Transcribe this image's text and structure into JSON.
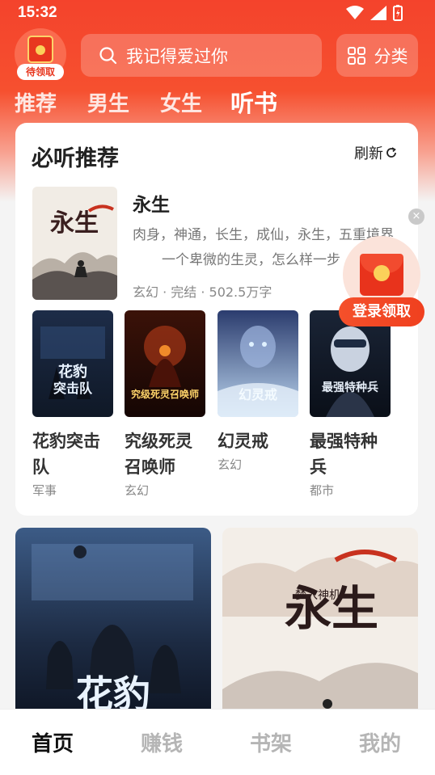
{
  "status_bar": {
    "time": "15:32"
  },
  "header": {
    "redpacket_label": "待领取",
    "search_placeholder": "我记得爱过你",
    "category_label": "分类"
  },
  "tabs": [
    {
      "label": "推荐",
      "active": false
    },
    {
      "label": "男生",
      "active": false
    },
    {
      "label": "女生",
      "active": false
    },
    {
      "label": "听书",
      "active": true
    }
  ],
  "section": {
    "title": "必听推荐",
    "refresh_label": "刷新"
  },
  "featured": {
    "title": "永生",
    "desc_line1": "肉身，神通，长生，成仙，永生，五重境界",
    "desc_line2": "一个卑微的生灵，怎么样一步",
    "meta": "玄幻 · 完结 · 502.5万字",
    "cover_text": "永生"
  },
  "books": [
    {
      "name": "花豹突击队",
      "genre": "军事",
      "cover_text": "花豹突击队"
    },
    {
      "name": "究级死灵召唤师",
      "genre": "玄幻",
      "cover_text": "究级死灵召唤师"
    },
    {
      "name": "幻灵戒",
      "genre": "玄幻",
      "cover_text": "幻灵戒"
    },
    {
      "name": "最强特种兵",
      "genre": "都市",
      "cover_text": "最强特种兵"
    }
  ],
  "floating": {
    "close_label": "×",
    "claim_label": "登录领取"
  },
  "big_covers": [
    {
      "text": "花豹"
    },
    {
      "text_main": "永生",
      "text_side": "梦入神机"
    }
  ],
  "bottom_nav": [
    {
      "label": "首页",
      "active": true
    },
    {
      "label": "赚钱",
      "active": false
    },
    {
      "label": "书架",
      "active": false
    },
    {
      "label": "我的",
      "active": false
    }
  ]
}
